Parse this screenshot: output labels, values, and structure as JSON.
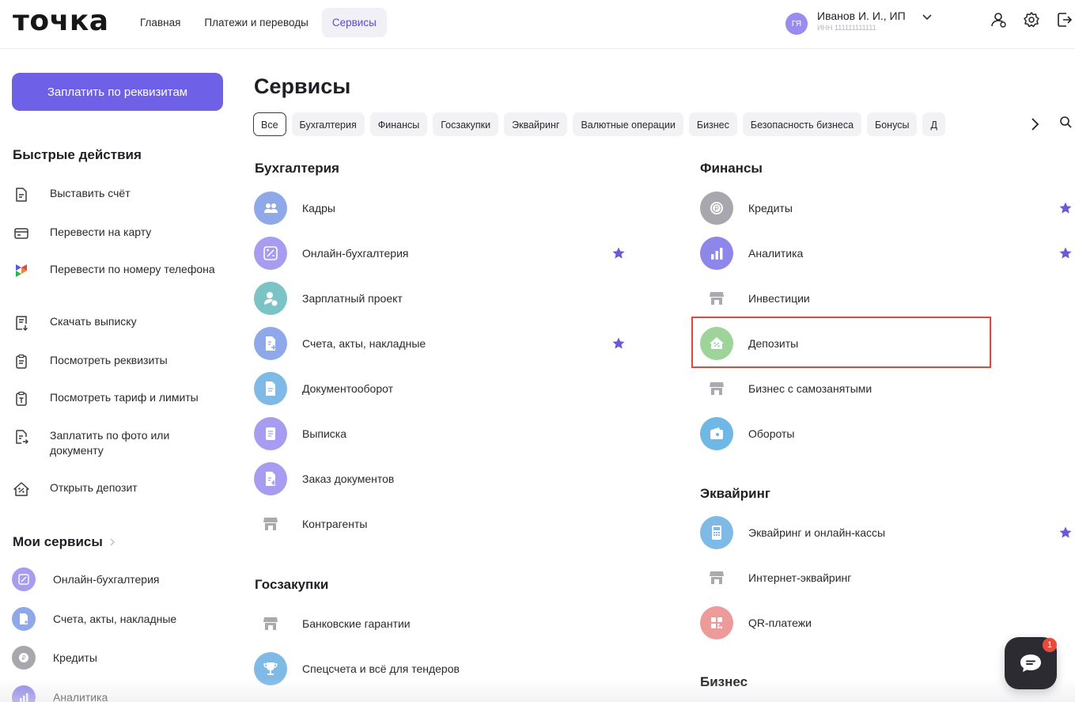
{
  "header": {
    "logo": "точка",
    "nav": [
      {
        "label": "Главная",
        "icon": null
      },
      {
        "label": "Платежи и переводы",
        "icon": null
      },
      {
        "label": "Сервисы",
        "icon": null
      }
    ],
    "account": {
      "initials": "ГЯ",
      "name": "Иванов И. И., ИП",
      "inn": "ИНН 111111111111"
    }
  },
  "sidebar": {
    "pay_button": "Заплатить по реквизитам",
    "quick_title": "Быстрые действия",
    "quick_actions": [
      {
        "label": "Выставить счёт",
        "icon": "invoice-icon"
      },
      {
        "label": "Перевести на карту",
        "icon": "card-icon"
      },
      {
        "label": "Перевести по номеру телефона",
        "icon": "sbp-icon"
      },
      {
        "label": "Скачать выписку",
        "icon": "statement-download-icon"
      },
      {
        "label": "Посмотреть реквизиты",
        "icon": "requisites-icon"
      },
      {
        "label": "Посмотреть тариф и лимиты",
        "icon": "tariff-icon"
      },
      {
        "label": "Заплатить по фото или документу",
        "icon": "photo-pay-icon"
      },
      {
        "label": "Открыть депозит",
        "icon": "deposit-icon"
      }
    ],
    "my_services_title": "Мои сервисы",
    "my_services": [
      {
        "label": "Онлайн-бухгалтерия",
        "icon": "percent-icon",
        "color": "#a79df0"
      },
      {
        "label": "Счета, акты, накладные",
        "icon": "document-plus-icon",
        "color": "#8fa8ea"
      },
      {
        "label": "Кредиты",
        "icon": "coin-icon",
        "color": "#a7a7ad"
      },
      {
        "label": "Аналитика",
        "icon": "chart-icon",
        "color": "#8e86e8"
      }
    ]
  },
  "main": {
    "title": "Сервисы",
    "chips": [
      "Все",
      "Бухгалтерия",
      "Финансы",
      "Госзакупки",
      "Эквайринг",
      "Валютные операции",
      "Бизнес",
      "Безопасность бизнеса",
      "Бонусы",
      "Д"
    ],
    "sections": {
      "accounting": {
        "title": "Бухгалтерия",
        "items": [
          {
            "label": "Кадры",
            "icon": "people-icon",
            "color": "#8fa8ea",
            "starred": false
          },
          {
            "label": "Онлайн-бухгалтерия",
            "icon": "percent-icon",
            "color": "#a79df0",
            "starred": true
          },
          {
            "label": "Зарплатный проект",
            "icon": "salary-icon",
            "color": "#7cc3c6",
            "starred": false
          },
          {
            "label": "Счета, акты, накладные",
            "icon": "document-plus-icon",
            "color": "#8fa8ea",
            "starred": true
          },
          {
            "label": "Документооборот",
            "icon": "document-icon",
            "color": "#7fb9e6",
            "starred": false
          },
          {
            "label": "Выписка",
            "icon": "statement-icon",
            "color": "#a79df0",
            "starred": false
          },
          {
            "label": "Заказ документов",
            "icon": "order-docs-icon",
            "color": "#a79df0",
            "starred": false
          },
          {
            "label": "Контрагенты",
            "icon": "store-icon",
            "color": "#ffffff",
            "starred": false
          }
        ]
      },
      "procurement": {
        "title": "Госзакупки",
        "items": [
          {
            "label": "Банковские гарантии",
            "icon": "store-icon",
            "color": "#ffffff"
          },
          {
            "label": "Спецсчета и всё для тендеров",
            "icon": "trophy-icon",
            "color": "#7fb9e6"
          }
        ]
      },
      "finance": {
        "title": "Финансы",
        "items": [
          {
            "label": "Кредиты",
            "icon": "coin-icon",
            "color": "#a7a7ad",
            "starred": true
          },
          {
            "label": "Аналитика",
            "icon": "chart-icon",
            "color": "#8e86e8",
            "starred": true
          },
          {
            "label": "Инвестиции",
            "icon": "store-icon",
            "color": "#ffffff",
            "starred": false
          },
          {
            "label": "Депозиты",
            "icon": "deposit-icon",
            "color": "#9ed49a",
            "starred": false
          },
          {
            "label": "Бизнес с самозанятыми",
            "icon": "store-icon",
            "color": "#ffffff",
            "starred": false
          },
          {
            "label": "Обороты",
            "icon": "wallet-icon",
            "color": "#6fb8e6",
            "starred": false
          }
        ]
      },
      "acquiring": {
        "title": "Эквайринг",
        "items": [
          {
            "label": "Эквайринг и онлайн-кассы",
            "icon": "cash-register-icon",
            "color": "#7fb9e6",
            "starred": true
          },
          {
            "label": "Интернет-эквайринг",
            "icon": "store-icon",
            "color": "#ffffff",
            "starred": false
          },
          {
            "label": "QR-платежи",
            "icon": "qr-icon",
            "color": "#ec9a9a",
            "starred": false
          }
        ]
      },
      "business": {
        "title": "Бизнес"
      }
    }
  },
  "chat": {
    "badge": "1"
  },
  "colors": {
    "accent": "#6f60e8",
    "star": "#6a5ad8",
    "highlight": "#e4463c"
  }
}
